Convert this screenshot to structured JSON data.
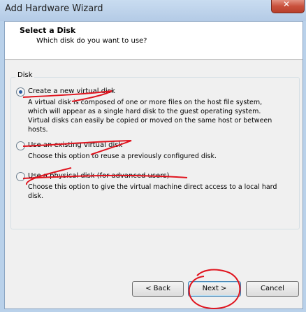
{
  "window": {
    "title": "Add Hardware Wizard",
    "close_symbol": "✕"
  },
  "header": {
    "title": "Select a Disk",
    "subtitle": "Which disk do you want to use?"
  },
  "group": {
    "label": "Disk",
    "options": [
      {
        "label": "Create a new virtual disk",
        "description": "A virtual disk is composed of one or more files on the host file system, which will appear as a single hard disk to the guest operating system. Virtual disks can easily be copied or moved on the same host or between hosts.",
        "selected": true
      },
      {
        "label": "Use an existing virtual disk",
        "description": "Choose this option to reuse a previously configured disk.",
        "selected": false
      },
      {
        "label": "Use a physical disk (for advanced users)",
        "description": "Choose this option to give the virtual machine direct access to a local hard disk.",
        "selected": false
      }
    ]
  },
  "buttons": {
    "back": "< Back",
    "next": "Next >",
    "cancel": "Cancel"
  },
  "colors": {
    "annotation_ink": "#e0141e",
    "radio_dot": "#2a5aa0"
  },
  "icons": [
    "close-icon"
  ]
}
